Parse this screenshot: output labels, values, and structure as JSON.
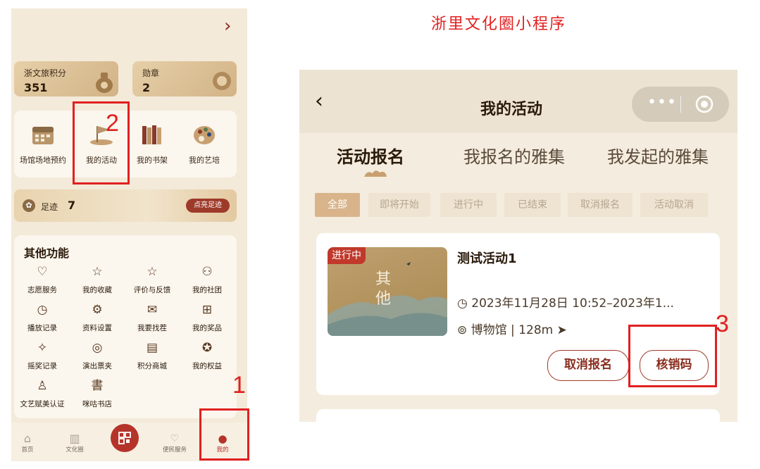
{
  "caption": "浙里文化圈小程序",
  "left": {
    "points_card": {
      "label": "浙文旅积分",
      "value": "351"
    },
    "medal_card": {
      "label": "勋章",
      "value": "2"
    },
    "quick": [
      {
        "label": "场馆场地预约",
        "icon": "calendar-icon"
      },
      {
        "label": "我的活动",
        "icon": "flag-icon"
      },
      {
        "label": "我的书架",
        "icon": "books-icon"
      },
      {
        "label": "我的艺培",
        "icon": "palette-icon"
      }
    ],
    "footprint": {
      "label": "足迹",
      "count": "7",
      "button": "点亮足迹"
    },
    "other": {
      "title": "其他功能",
      "items": [
        {
          "label": "志愿服务",
          "icon": "heart-icon",
          "glyph": "♡"
        },
        {
          "label": "我的收藏",
          "icon": "star-box-icon",
          "glyph": "☆"
        },
        {
          "label": "评价与反馈",
          "icon": "star-icon",
          "glyph": "☆"
        },
        {
          "label": "我的社团",
          "icon": "group-icon",
          "glyph": "⚇"
        },
        {
          "label": "播放记录",
          "icon": "clock-icon",
          "glyph": "◷"
        },
        {
          "label": "资料设置",
          "icon": "gear-icon",
          "glyph": "⚙"
        },
        {
          "label": "我要找茬",
          "icon": "mail-icon",
          "glyph": "✉"
        },
        {
          "label": "我的奖品",
          "icon": "gift-icon",
          "glyph": "⊞"
        },
        {
          "label": "摇奖记录",
          "icon": "shake-icon",
          "glyph": "✧"
        },
        {
          "label": "演出票夹",
          "icon": "ticket-icon",
          "glyph": "◎"
        },
        {
          "label": "积分商城",
          "icon": "shop-icon",
          "glyph": "▤"
        },
        {
          "label": "我的权益",
          "icon": "badge-icon",
          "glyph": "✪"
        },
        {
          "label": "文艺赋美认证",
          "icon": "person-icon",
          "glyph": "♙"
        },
        {
          "label": "咪咕书店",
          "icon": "book-char-icon",
          "glyph": "書"
        }
      ]
    },
    "nav": [
      {
        "label": "首页",
        "icon": "home-icon"
      },
      {
        "label": "文化圈",
        "icon": "culture-icon"
      },
      {
        "label": "",
        "icon": "qr-icon"
      },
      {
        "label": "便民服务",
        "icon": "service-icon"
      },
      {
        "label": "我的",
        "icon": "me-icon"
      }
    ]
  },
  "right": {
    "title": "我的活动",
    "tabs": [
      "活动报名",
      "我报名的雅集",
      "我发起的雅集"
    ],
    "filters": [
      "全部",
      "即将开始",
      "进行中",
      "已结束",
      "取消报名",
      "活动取消"
    ],
    "activity": {
      "badge": "进行中",
      "thumb_text": "其他",
      "title": "测试活动1",
      "time": "2023年11月28日 10:52–2023年1...",
      "location": "博物馆 | 128m",
      "cancel_btn": "取消报名",
      "verify_btn": "核销码"
    }
  },
  "annotations": [
    "1",
    "2",
    "3"
  ]
}
